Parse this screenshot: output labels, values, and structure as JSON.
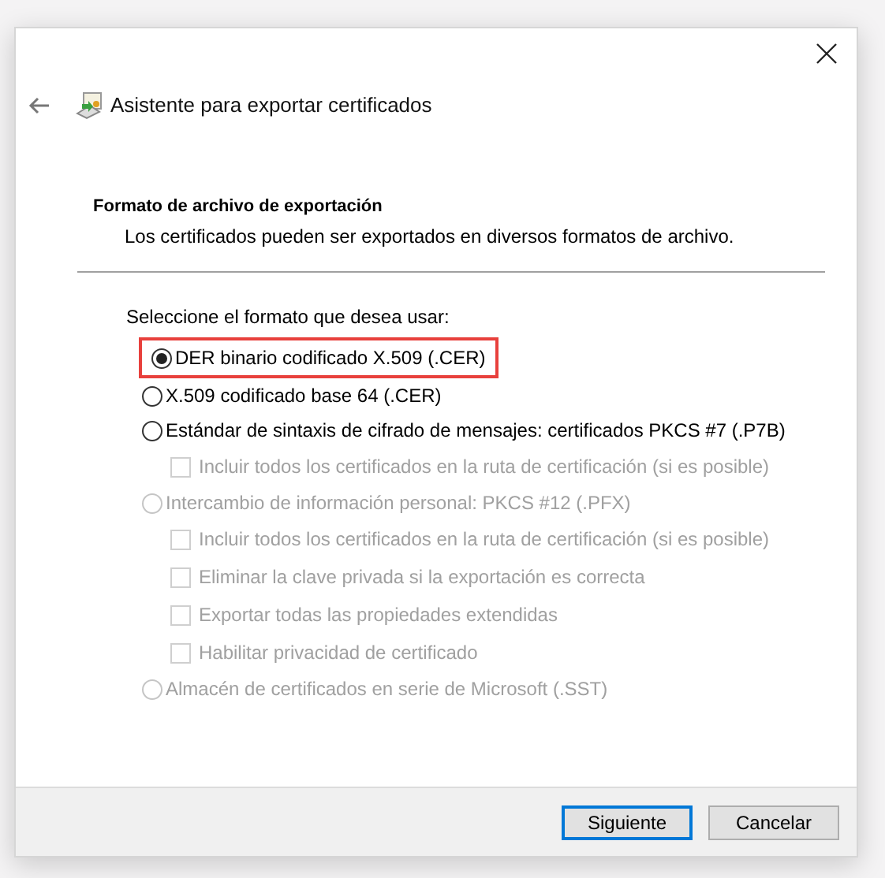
{
  "window": {
    "title": "Asistente para exportar certificados"
  },
  "section": {
    "heading": "Formato de archivo de exportación",
    "description": "Los certificados pueden ser exportados en diversos formatos de archivo."
  },
  "prompt": "Seleccione el formato que desea usar:",
  "options": [
    {
      "label": "DER binario codificado X.509 (.CER)",
      "selected": true,
      "disabled": false,
      "highlighted": true
    },
    {
      "label": "X.509 codificado base 64 (.CER)",
      "selected": false,
      "disabled": false,
      "highlighted": false
    },
    {
      "label": "Estándar de sintaxis de cifrado de mensajes: certificados PKCS #7 (.P7B)",
      "selected": false,
      "disabled": false,
      "highlighted": false,
      "children": [
        {
          "label": "Incluir todos los certificados en la ruta de certificación (si es posible)",
          "checked": false,
          "disabled": true
        }
      ]
    },
    {
      "label": "Intercambio de información personal: PKCS #12 (.PFX)",
      "selected": false,
      "disabled": true,
      "highlighted": false,
      "children": [
        {
          "label": "Incluir todos los certificados en la ruta de certificación (si es posible)",
          "checked": false,
          "disabled": true
        },
        {
          "label": "Eliminar la clave privada si la exportación es correcta",
          "checked": false,
          "disabled": true
        },
        {
          "label": "Exportar todas las propiedades extendidas",
          "checked": false,
          "disabled": true
        },
        {
          "label": "Habilitar privacidad de certificado",
          "checked": false,
          "disabled": true
        }
      ]
    },
    {
      "label": "Almacén de certificados en serie de Microsoft (.SST)",
      "selected": false,
      "disabled": true,
      "highlighted": false
    }
  ],
  "buttons": [
    {
      "label": "Siguiente",
      "selected": true
    },
    {
      "label": "Cancelar",
      "selected": false
    }
  ]
}
